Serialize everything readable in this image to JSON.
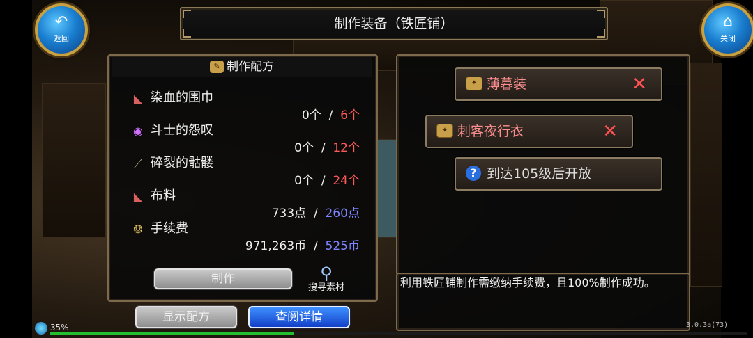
{
  "title": "制作装备（铁匠铺）",
  "nav": {
    "back_label": "返回",
    "close_label": "关闭"
  },
  "recipe": {
    "header": "制作配方",
    "materials": [
      {
        "icon": "scarf-icon",
        "name": "染血的围巾",
        "owned": "0个",
        "sep": "/",
        "required": "6个",
        "required_color": "red"
      },
      {
        "icon": "orb-icon",
        "name": "斗士的怨叹",
        "owned": "0个",
        "sep": "/",
        "required": "12个",
        "required_color": "red"
      },
      {
        "icon": "skull-shard-icon",
        "name": "碎裂的骷髅",
        "owned": "0个",
        "sep": "/",
        "required": "24个",
        "required_color": "red"
      },
      {
        "icon": "cloth-icon",
        "name": "布料",
        "owned": "733点",
        "sep": "/",
        "required": "260点",
        "required_color": "blue"
      },
      {
        "icon": "coins-icon",
        "name": "手续费",
        "owned": "971,263币",
        "sep": "/",
        "required": "525币",
        "required_color": "blue"
      }
    ],
    "craft_button": "制作",
    "search_label": "搜寻素材"
  },
  "bottom_buttons": {
    "show_recipe": "显示配方",
    "view_details": "查阅详情"
  },
  "outfits": [
    {
      "name": "薄暮装",
      "state": "selectable"
    },
    {
      "name": "刺客夜行衣",
      "state": "selectable"
    },
    {
      "name": "到达105级后开放",
      "state": "locked"
    }
  ],
  "description": "利用铁匠铺制作需缴纳手续费，且100%制作成功。",
  "status": {
    "percent_label": "35%",
    "progress": 0.35,
    "version": "3.0.3a(73)"
  },
  "colors": {
    "red": "#ff5a5a",
    "blue": "#7f86ff",
    "accent_gold": "#c8a040"
  }
}
